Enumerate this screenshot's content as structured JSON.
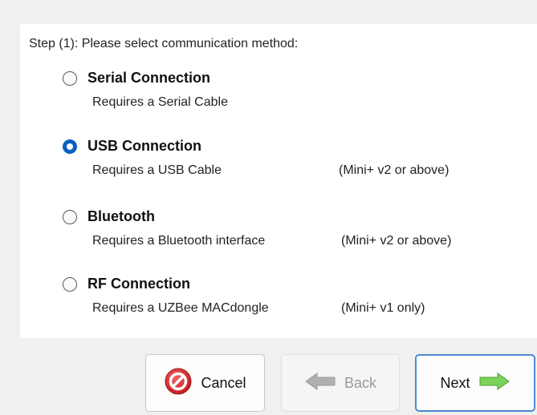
{
  "step_label": "Step (1): Please select communication method:",
  "options": [
    {
      "title": "Serial Connection",
      "desc": "Requires a Serial Cable",
      "note": "",
      "selected": false
    },
    {
      "title": "USB Connection",
      "desc": "Requires a USB Cable",
      "note": "(Mini+ v2 or above)",
      "selected": true
    },
    {
      "title": "Bluetooth",
      "desc": "Requires a Bluetooth interface",
      "note": "(Mini+ v2 or above)",
      "selected": false
    },
    {
      "title": "RF Connection",
      "desc": "Requires a UZBee MACdongle",
      "note": "(Mini+ v1 only)",
      "selected": false
    }
  ],
  "buttons": {
    "cancel_label": "Cancel",
    "back_label": "Back",
    "next_label": "Next"
  },
  "icons": {
    "cancel": "no-entry-icon",
    "back": "arrow-left-icon",
    "next": "arrow-right-icon"
  },
  "colors": {
    "radio_selected": "#0a5fc2",
    "cancel_icon": "#d9262b",
    "next_arrow": "#7cd35a",
    "back_arrow": "#b0b0b0",
    "next_border": "#4a8ad0"
  }
}
